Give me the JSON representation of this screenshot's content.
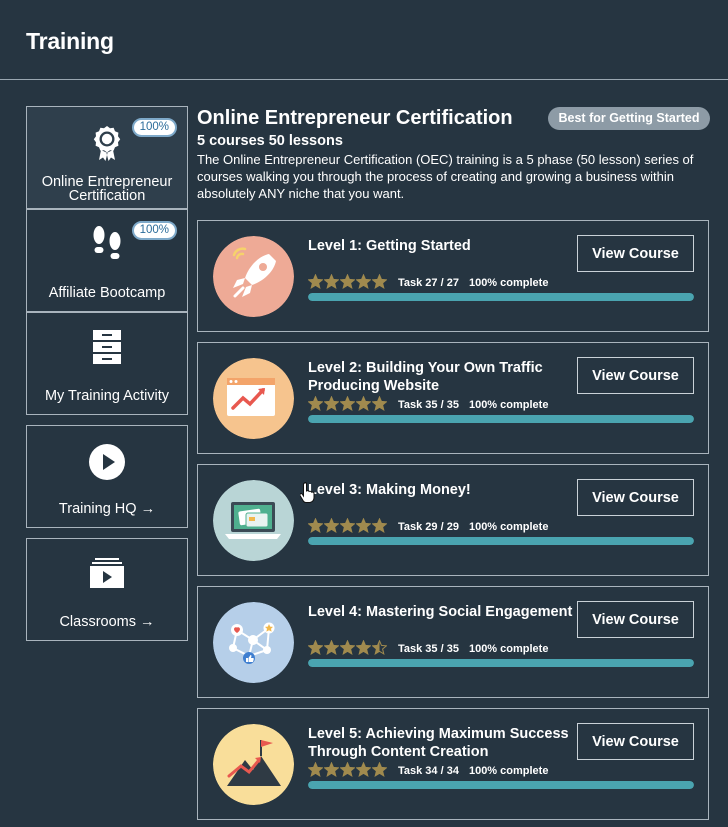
{
  "header": {
    "title": "Training"
  },
  "sidebar": [
    {
      "label": "Online Entrepreneur Certification",
      "badge": "100%",
      "icon": "award-icon"
    },
    {
      "label": "Affiliate Bootcamp",
      "badge": "100%",
      "icon": "footprints-icon"
    },
    {
      "label": "My Training Activity",
      "icon": "cabinet-icon"
    },
    {
      "label": "Training HQ →",
      "icon": "play-icon"
    },
    {
      "label": "Classrooms →",
      "icon": "classroom-icon"
    }
  ],
  "main": {
    "title": "Online Entrepreneur Certification",
    "tag": "Best for Getting Started",
    "subtitle": "5 courses 50 lessons",
    "description": "The Online Entrepreneur Certification (OEC) training is a 5 phase (50 lesson) series of courses walking you through the process of creating and growing a business within absolutely ANY niche that you want."
  },
  "courses": [
    {
      "title": "Level 1: Getting Started",
      "task": "Task 27 / 27",
      "complete": "100% complete",
      "progress": 1.0,
      "rating": 5,
      "button": "View Course",
      "thumb_color": "#eeaa96",
      "icon": "rocket-icon"
    },
    {
      "title": "Level 2: Building Your Own Traffic Producing Website",
      "task": "Task 35 / 35",
      "complete": "100% complete",
      "progress": 1.0,
      "rating": 5,
      "button": "View Course",
      "thumb_color": "#f6c48e",
      "icon": "website-chart-icon"
    },
    {
      "title": "Level 3: Making Money!",
      "task": "Task 29 / 29",
      "complete": "100% complete",
      "progress": 1.0,
      "rating": 5,
      "button": "View Course",
      "thumb_color": "#b9d5d6",
      "icon": "laptop-card-icon"
    },
    {
      "title": "Level 4: Mastering Social Engagement",
      "task": "Task 35 / 35",
      "complete": "100% complete",
      "progress": 1.0,
      "rating": 4.5,
      "button": "View Course",
      "thumb_color": "#b6cfe9",
      "icon": "social-network-icon"
    },
    {
      "title": "Level 5: Achieving Maximum Success Through Content Creation",
      "task": "Task 34 / 34",
      "complete": "100% complete",
      "progress": 1.0,
      "rating": 5,
      "button": "View Course",
      "thumb_color": "#f9de9a",
      "icon": "mountain-flag-icon"
    }
  ],
  "colors": {
    "background": "#263541",
    "star": "#a08a4e",
    "progress": "#4aa4b0",
    "badge_text": "#2b6c9a"
  }
}
